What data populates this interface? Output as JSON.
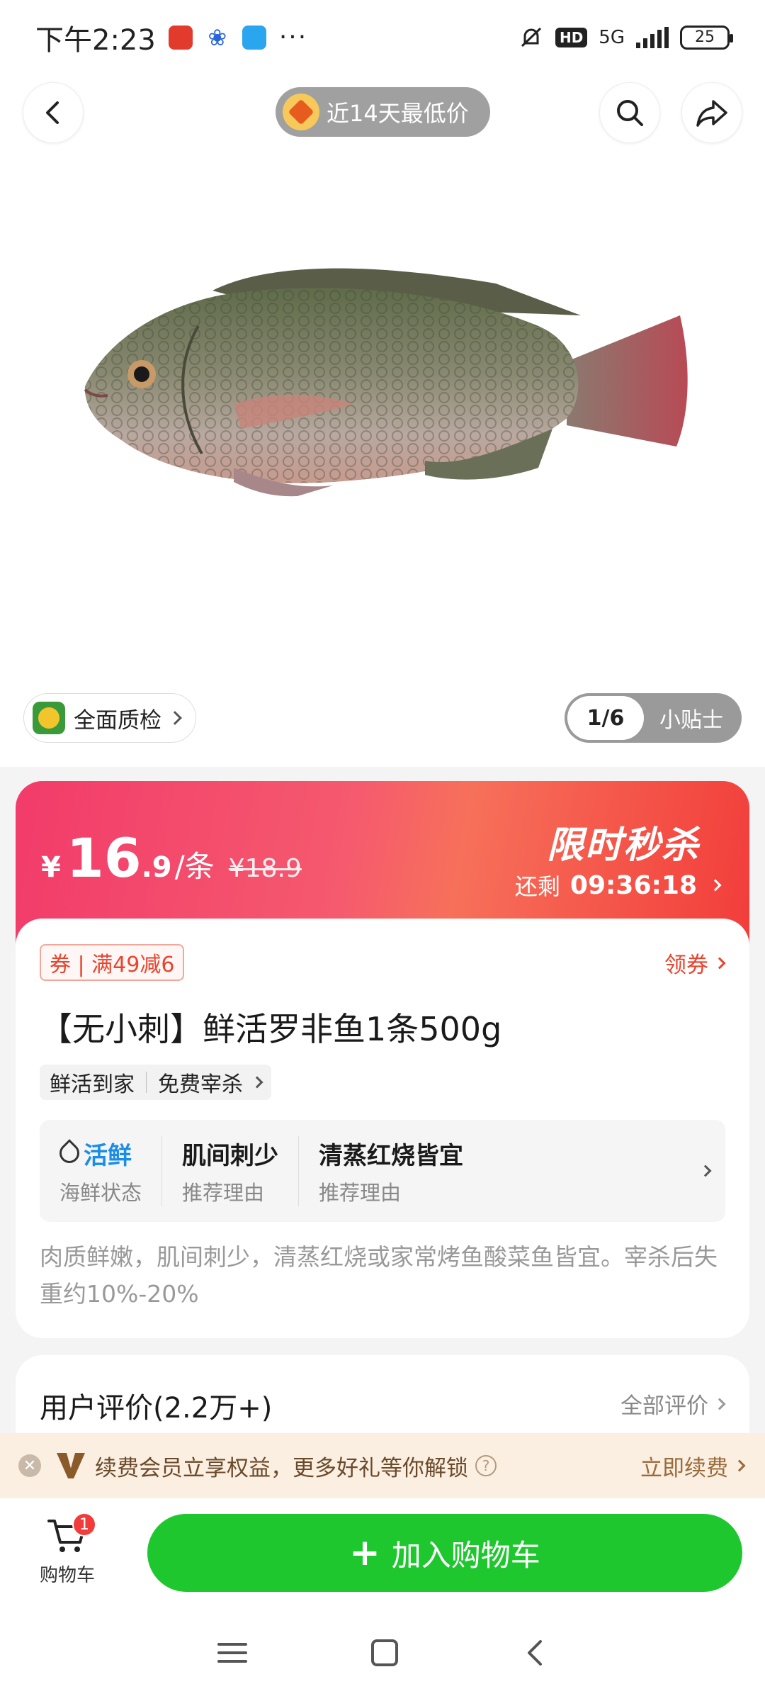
{
  "status_bar": {
    "time": "下午2:23",
    "more": "···",
    "hd": "HD",
    "network": "5G",
    "battery": "25"
  },
  "nav": {
    "low_price_badge": "近14天最低价"
  },
  "gallery": {
    "quality_check": "全面质检",
    "page_counter": "1/6",
    "tips": "小贴士"
  },
  "price": {
    "currency": "¥",
    "integer": "16",
    "decimal": ".9",
    "unit": "/条",
    "original": "¥18.9",
    "flash_sale": "限时秒杀",
    "remaining_label": "还剩",
    "countdown": "09:36:18"
  },
  "product": {
    "coupon": "券 | 满49减6",
    "get_coupon": "领券",
    "title": "【无小刺】鲜活罗非鱼1条500g",
    "service_tags": [
      "鲜活到家",
      "免费宰杀"
    ],
    "features": [
      {
        "value": "活鲜",
        "label": "海鲜状态"
      },
      {
        "value": "肌间刺少",
        "label": "推荐理由"
      },
      {
        "value": "清蒸红烧皆宜",
        "label": "推荐理由"
      }
    ],
    "description": "肉质鲜嫩，肌间刺少，清蒸红烧或家常烤鱼酸菜鱼皆宜。宰杀后失重约10%-20%"
  },
  "reviews": {
    "title": "用户评价(2.2万+)",
    "all": "全部评价"
  },
  "member": {
    "text": "续费会员立享权益，更多好礼等你解锁",
    "renew": "立即续费"
  },
  "bottom": {
    "cart_label": "购物车",
    "cart_count": "1",
    "add_to_cart": "加入购物车"
  },
  "colors": {
    "accent_green": "#1fc72f",
    "price_red": "#f23b6a",
    "coupon_red": "#e8442e",
    "live_blue": "#1a8de8"
  }
}
